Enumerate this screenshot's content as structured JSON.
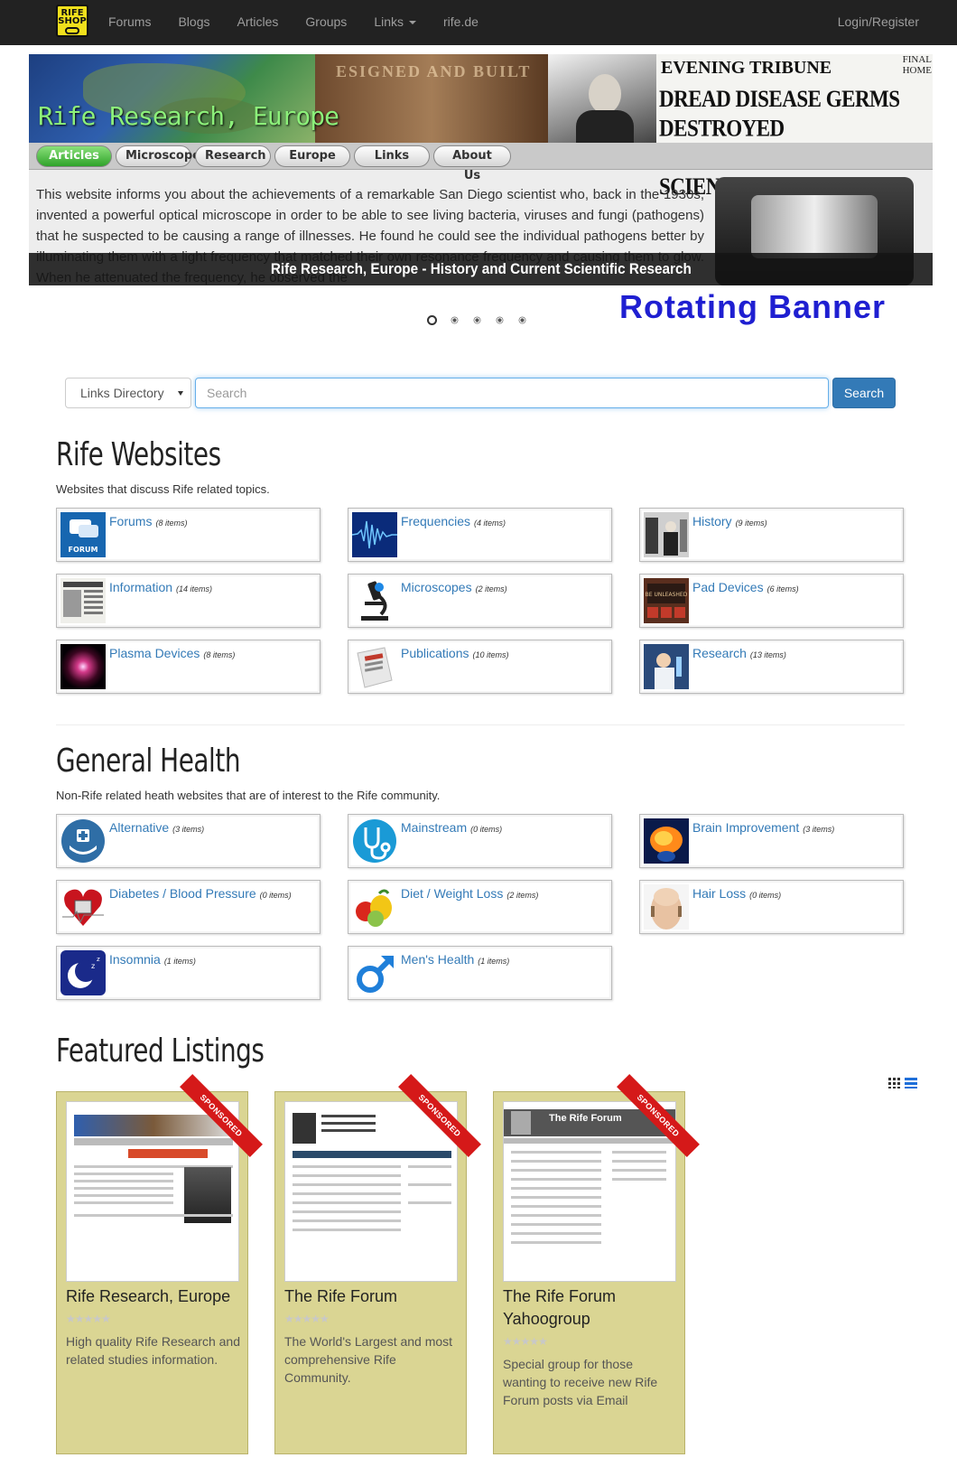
{
  "navbar": {
    "logo_top": "RIFE",
    "logo_bottom": "SHOP",
    "items": [
      "Forums",
      "Blogs",
      "Articles",
      "Groups",
      "Links",
      "rife.de"
    ],
    "login": "Login/Register"
  },
  "banner": {
    "title": "Rife Research, Europe",
    "book_text": "ESIGNED AND BUILT",
    "news_masthead": "EVENING TRIBUNE",
    "news_edition": "FINAL HOME",
    "news_headline_1": "DREAD DISEASE GERMS DESTROYED",
    "news_headline_2": "BY RAYS, CLAIM OF S. D. SCIENTIST",
    "tabs": [
      "Articles",
      "Microscope",
      "Research",
      "Europe",
      "Links",
      "About Us"
    ],
    "text": "This website informs you about the achievements of a remarkable San Diego scientist who, back in the 1930s, invented a powerful optical microscope in order to be able to see living bacteria, viruses and fungi (pathogens) that he suspected to be causing a range of illnesses. He found he could see the individual pathogens better by illuminating them with a light frequency that matched their own resonance frequency and causing them to glow. When he attenuated the frequency, he observed the",
    "caption": "Rife Research, Europe - History and Current Scientific Research",
    "annotation": "Rotating Banner",
    "slide_count": 5,
    "active_slide": 1
  },
  "search": {
    "select_value": "Links Directory",
    "placeholder": "Search",
    "button": "Search"
  },
  "rife_websites": {
    "title": "Rife Websites",
    "description": "Websites that discuss Rife related topics.",
    "items": [
      {
        "name": "Forums",
        "count": "(8 items)",
        "icon": "forum-icon"
      },
      {
        "name": "Frequencies",
        "count": "(4 items)",
        "icon": "waveform-icon"
      },
      {
        "name": "History",
        "count": "(9 items)",
        "icon": "history-photo-icon"
      },
      {
        "name": "Information",
        "count": "(14 items)",
        "icon": "newspaper-icon"
      },
      {
        "name": "Microscopes",
        "count": "(2 items)",
        "icon": "microscope-icon"
      },
      {
        "name": "Pad Devices",
        "count": "(6 items)",
        "icon": "pad-device-icon"
      },
      {
        "name": "Plasma Devices",
        "count": "(8 items)",
        "icon": "plasma-icon"
      },
      {
        "name": "Publications",
        "count": "(10 items)",
        "icon": "book-icon"
      },
      {
        "name": "Research",
        "count": "(13 items)",
        "icon": "researcher-icon"
      }
    ]
  },
  "general_health": {
    "title": "General Health",
    "description": "Non-Rife related heath websites that are of interest to the Rife community.",
    "items": [
      {
        "name": "Alternative",
        "count": "(3 items)",
        "icon": "hands-cross-icon"
      },
      {
        "name": "Mainstream",
        "count": "(0 items)",
        "icon": "stethoscope-icon"
      },
      {
        "name": "Brain Improvement",
        "count": "(3 items)",
        "icon": "brain-icon"
      },
      {
        "name": "Diabetes / Blood Pressure",
        "count": "(0 items)",
        "icon": "heart-icon"
      },
      {
        "name": "Diet / Weight Loss",
        "count": "(2 items)",
        "icon": "fruit-icon"
      },
      {
        "name": "Hair Loss",
        "count": "(0 items)",
        "icon": "bald-head-icon"
      },
      {
        "name": "Insomnia",
        "count": "(1 items)",
        "icon": "moon-icon"
      },
      {
        "name": "Men's Health",
        "count": "(1 items)",
        "icon": "male-symbol-icon"
      }
    ]
  },
  "featured": {
    "title": "Featured Listings",
    "ribbon": "SPONSORED",
    "items": [
      {
        "title": "Rife Research, Europe",
        "stars": "★★★★★",
        "desc": "High quality Rife Research and related studies information."
      },
      {
        "title": "The Rife Forum",
        "stars": "★★★★★",
        "desc": "The World's Largest and most comprehensive Rife Community."
      },
      {
        "title": "The Rife Forum Yahoogroup",
        "stars": "★★★★★",
        "desc": "Special group for those wanting to receive new Rife Forum posts via Email",
        "shot_title": "The Rife Forum"
      }
    ]
  },
  "colors": {
    "navbar_bg": "#222222",
    "link_blue": "#337ab7",
    "featured_bg": "#dad593",
    "ribbon_red": "#d51919",
    "annotation_blue": "#1f1fd1"
  }
}
